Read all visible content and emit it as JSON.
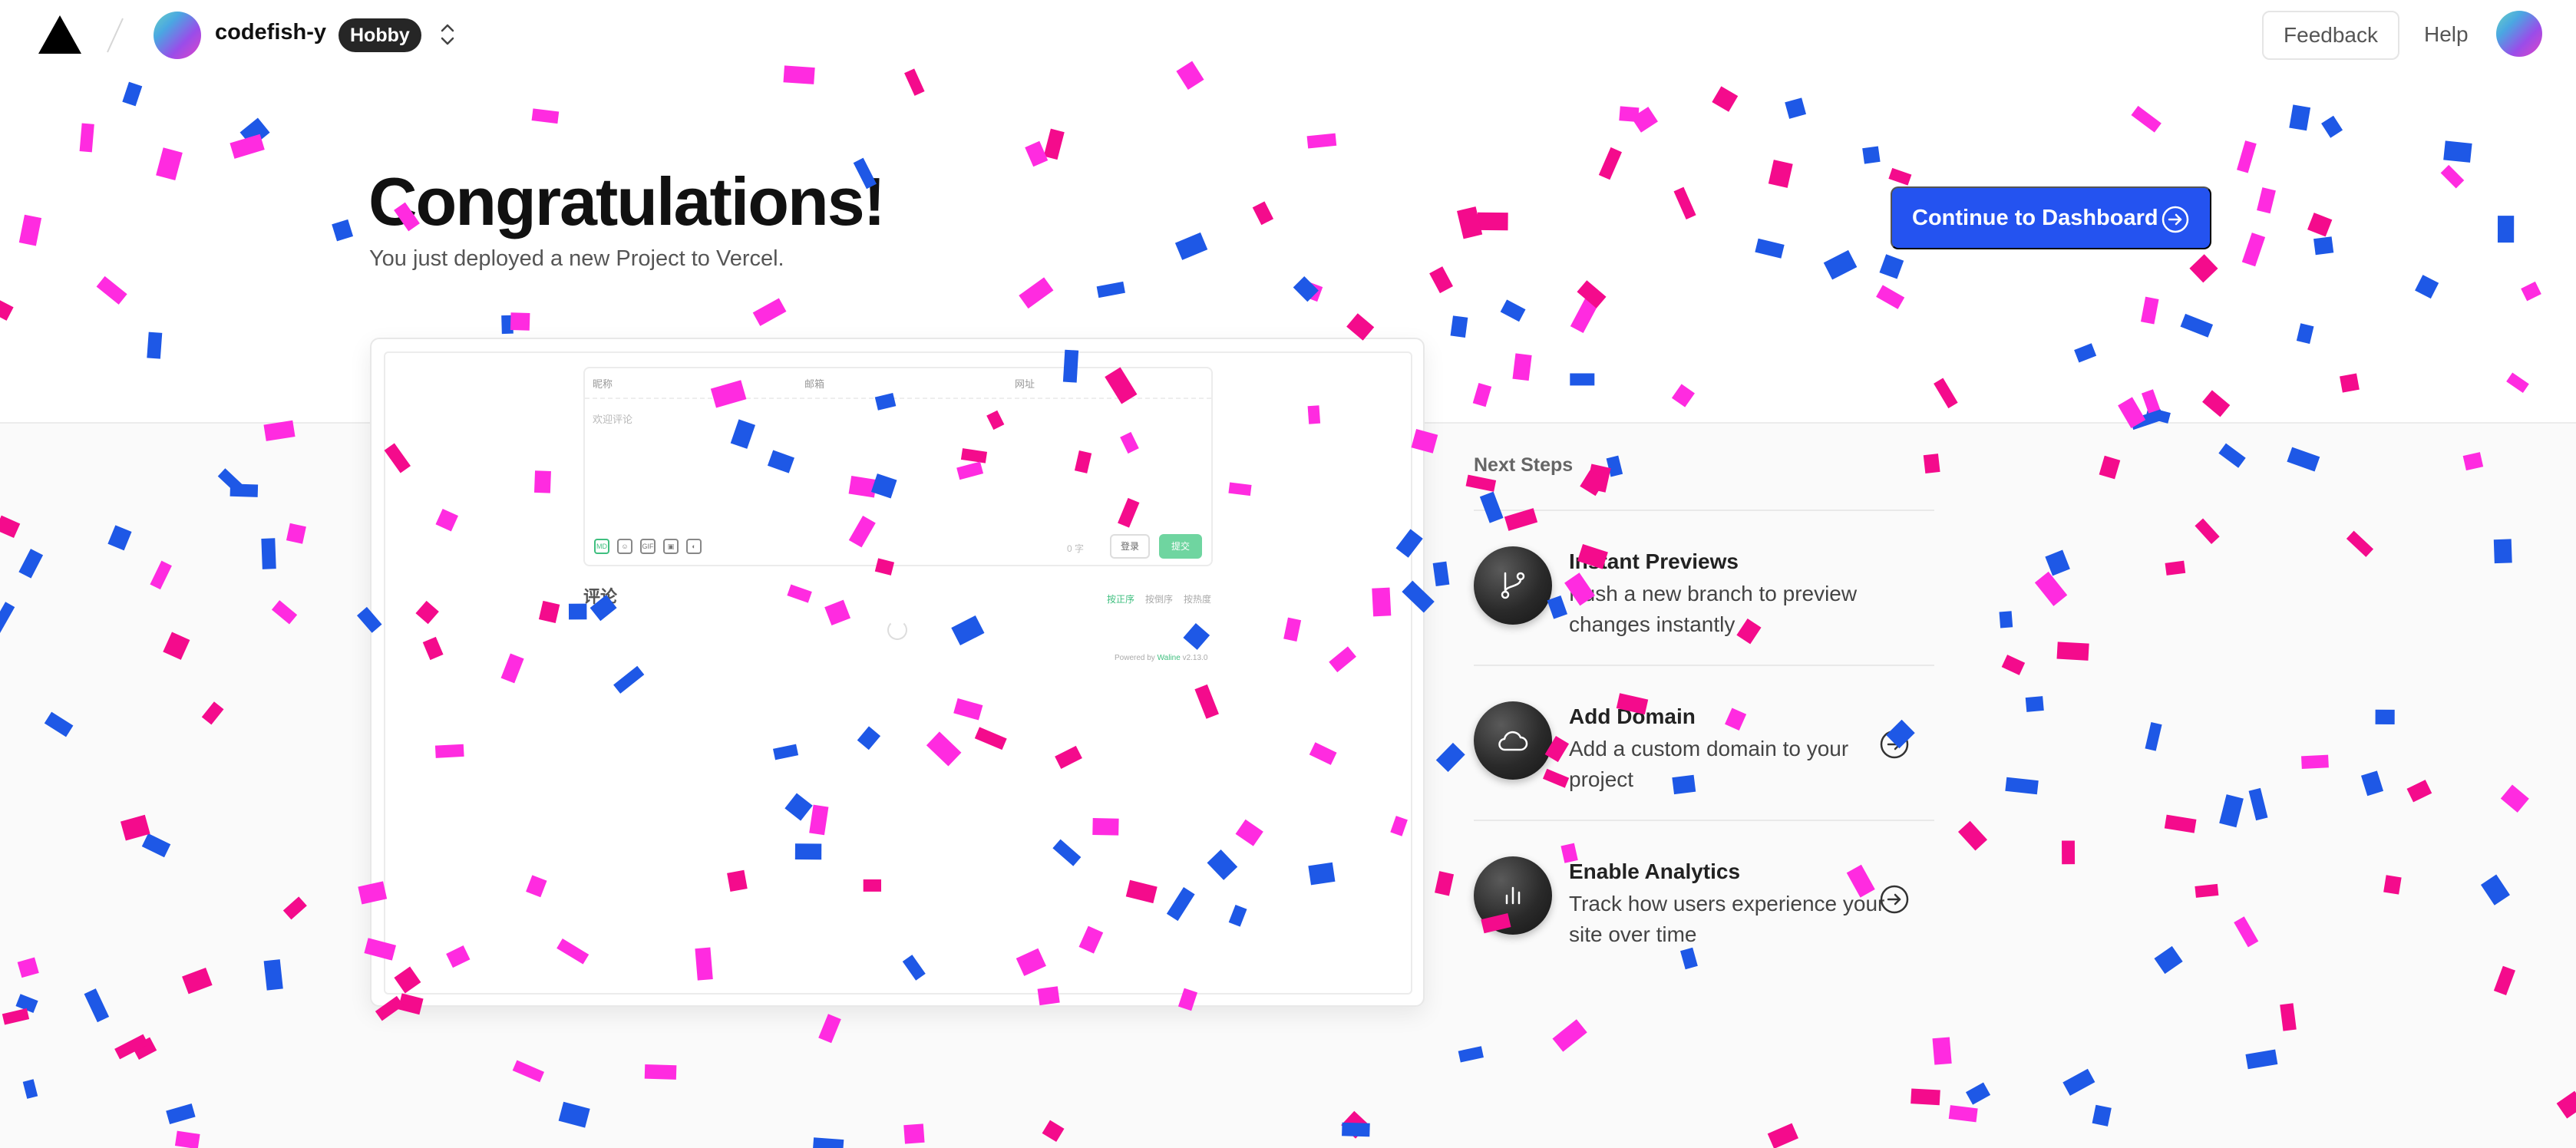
{
  "header": {
    "team_name": "codefish-y",
    "plan_badge": "Hobby",
    "feedback_label": "Feedback",
    "help_label": "Help"
  },
  "hero": {
    "title": "Congratulations!",
    "subtitle": "You just deployed a new Project to Vercel.",
    "dashboard_button": "Continue to Dashboard"
  },
  "preview": {
    "fields": [
      "昵称",
      "邮箱",
      "网址"
    ],
    "textarea_placeholder": "欢迎评论",
    "tools": [
      "MD",
      "☺",
      "GIF",
      "▣",
      "◐"
    ],
    "char_count": "0 字",
    "login_label": "登录",
    "submit_label": "提交",
    "comments_heading": "评论",
    "sort_options": [
      "按正序",
      "按倒序",
      "按热度"
    ],
    "powered_prefix": "Powered by",
    "powered_brand": "Waline",
    "powered_version": "v2.13.0"
  },
  "next_steps": {
    "heading": "Next Steps",
    "items": [
      {
        "title": "Instant Previews",
        "description": "Push a new branch to preview changes instantly",
        "icon": "git-branch-icon"
      },
      {
        "title": "Add Domain",
        "description": "Add a custom domain to your project",
        "icon": "cloud-icon"
      },
      {
        "title": "Enable Analytics",
        "description": "Track how users experience your site over time",
        "icon": "bar-chart-icon"
      }
    ]
  },
  "colors": {
    "accent": "#2453f0",
    "confetti_pink": "#f40b8c",
    "confetti_magenta": "#ff2be0",
    "confetti_blue": "#1e58e6"
  }
}
